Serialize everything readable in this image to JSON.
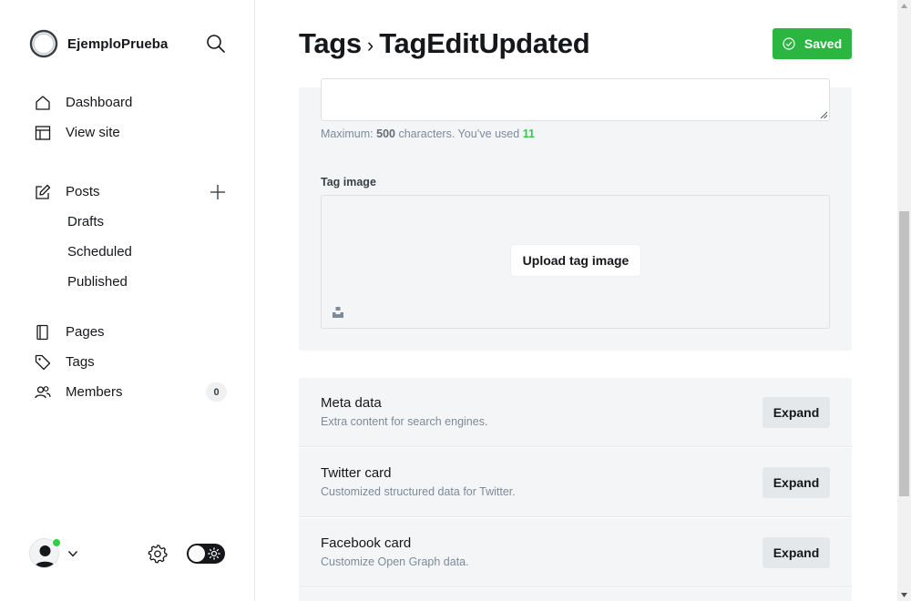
{
  "sidebar": {
    "brand": "EjemploPrueba",
    "nav_primary": [
      {
        "label": "Dashboard",
        "icon": "home-icon"
      },
      {
        "label": "View site",
        "icon": "layout-icon"
      }
    ],
    "posts": {
      "label": "Posts",
      "icon": "pencil-square-icon",
      "sub_items": [
        "Drafts",
        "Scheduled",
        "Published"
      ]
    },
    "nav_secondary": [
      {
        "label": "Pages",
        "icon": "page-icon"
      },
      {
        "label": "Tags",
        "icon": "tag-icon"
      },
      {
        "label": "Members",
        "icon": "members-icon",
        "count": "0"
      }
    ]
  },
  "header": {
    "breadcrumb_root": "Tags",
    "breadcrumb_separator": "›",
    "breadcrumb_current": "TagEditUpdated",
    "save_label": "Saved"
  },
  "form": {
    "char_count_prefix": "Maximum:",
    "char_count_max": "500",
    "char_count_middle": "characters. You’ve used",
    "char_count_used": "11",
    "tag_image_label": "Tag image",
    "upload_label": "Upload tag image"
  },
  "sections": [
    {
      "title": "Meta data",
      "description": "Extra content for search engines.",
      "button": "Expand"
    },
    {
      "title": "Twitter card",
      "description": "Customized structured data for Twitter.",
      "button": "Expand"
    },
    {
      "title": "Facebook card",
      "description": "Customize Open Graph data.",
      "button": "Expand"
    }
  ],
  "colors": {
    "accent_green": "#30cf43",
    "saved_button": "#2ab640",
    "panel_bg": "#f4f5f6",
    "text_primary": "#15171a",
    "text_muted": "#7c8b9a"
  },
  "user": {
    "online": true
  }
}
